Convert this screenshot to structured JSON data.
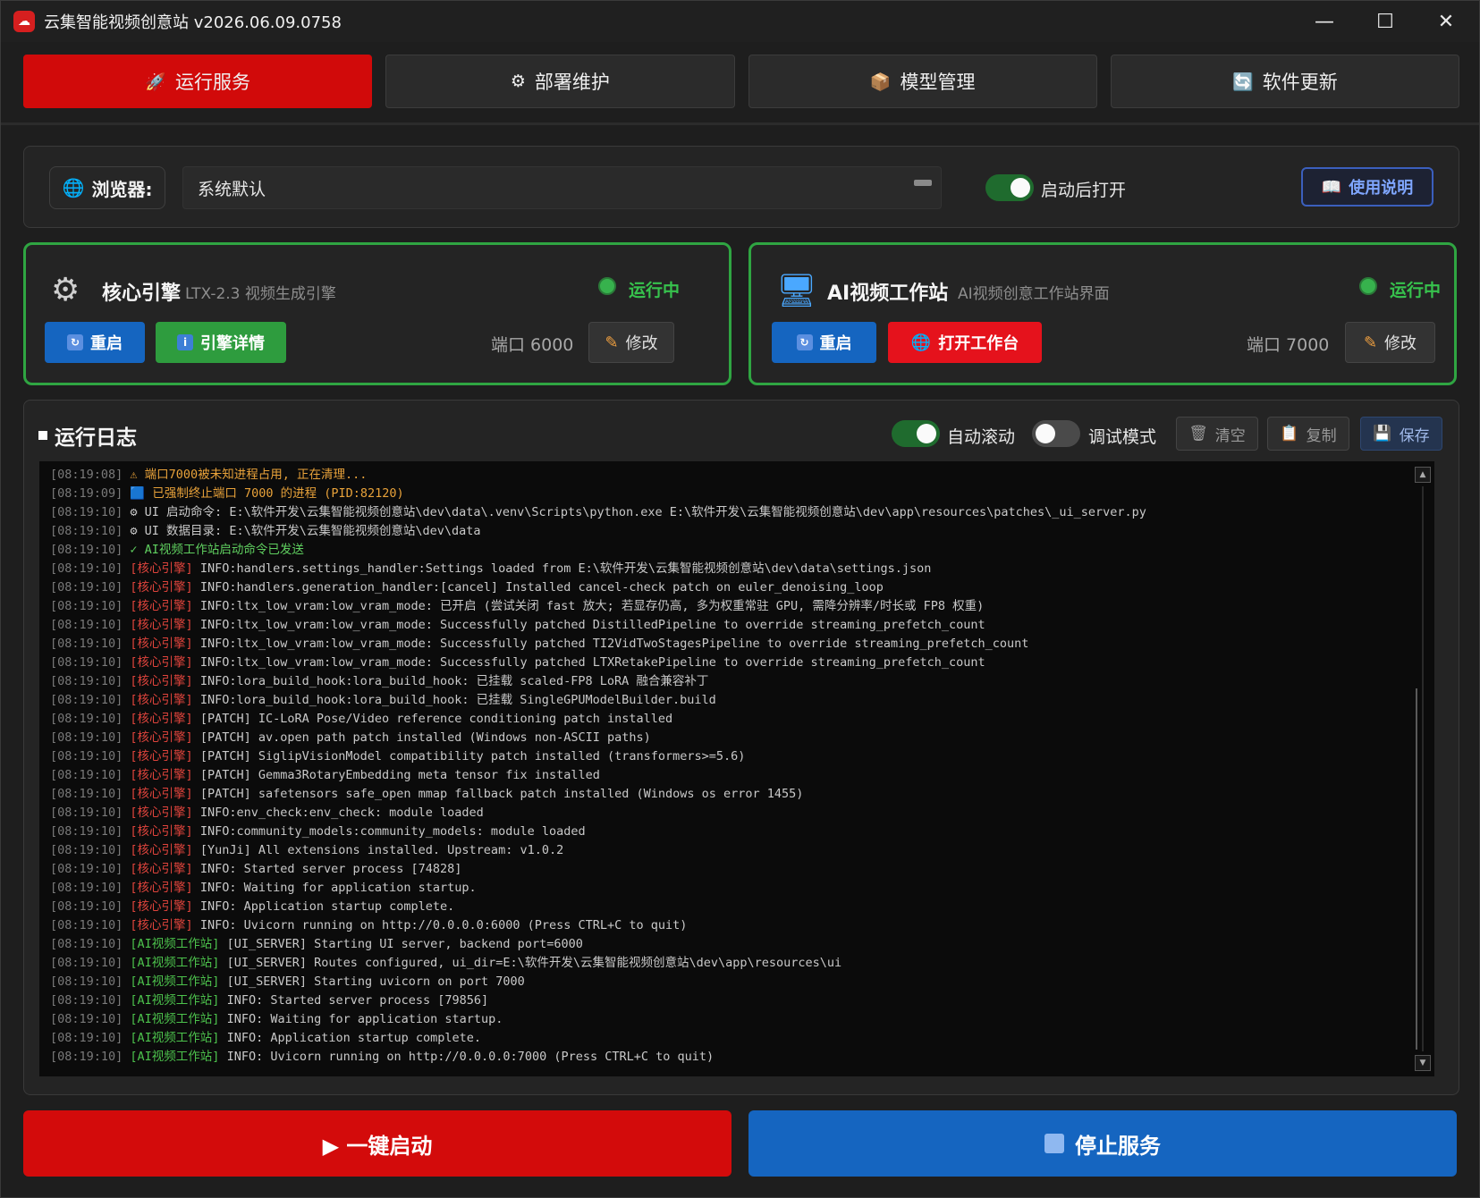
{
  "window": {
    "title": "云集智能视频创意站 v2026.06.09.0758",
    "minimize_label": "—",
    "maximize_label": "☐",
    "close_label": "✕"
  },
  "tabs": [
    {
      "icon": "🚀",
      "label": "运行服务",
      "active": true
    },
    {
      "icon": "⚙",
      "label": "部署维护",
      "active": false
    },
    {
      "icon": "📦",
      "label": "模型管理",
      "active": false
    },
    {
      "icon": "🔄",
      "label": "软件更新",
      "active": false
    }
  ],
  "browser": {
    "label": "浏览器:",
    "selected": "系统默认",
    "open_after_launch_label": "启动后打开",
    "open_after_launch": true,
    "manual_label": "使用说明"
  },
  "services": {
    "core": {
      "name": "核心引擎",
      "subtitle": "LTX-2.3 视频生成引擎",
      "status": "运行中",
      "restart_label": "重启",
      "details_label": "引擎详情",
      "port_text": "端口 6000",
      "edit_label": "修改"
    },
    "studio": {
      "name": "AI视频工作站",
      "subtitle": "AI视频创意工作站界面",
      "status": "运行中",
      "restart_label": "重启",
      "open_label": "打开工作台",
      "port_text": "端口 7000",
      "edit_label": "修改"
    }
  },
  "log": {
    "title": "运行日志",
    "auto_scroll_label": "自动滚动",
    "auto_scroll": true,
    "debug_label": "调试模式",
    "debug": false,
    "clear_label": "清空",
    "copy_label": "复制",
    "save_label": "保存",
    "colors": {
      "timestamp": "#7a7a7a",
      "warn": "#e8a23a",
      "info": "#c9c9c9",
      "success": "#5fcf5f",
      "core_tag": "#e0443c",
      "studio_tag": "#4cc24c"
    },
    "lines": [
      {
        "ts": "[08:19:08]",
        "tag": "",
        "tag_color": "",
        "msg": "⚠ 端口7000被未知进程占用, 正在清理...",
        "color": "#e8a23a"
      },
      {
        "ts": "[08:19:09]",
        "tag": "",
        "tag_color": "",
        "msg": "🟦 已强制终止端口 7000 的进程 (PID:82120)",
        "color": "#e8a23a"
      },
      {
        "ts": "[08:19:10]",
        "tag": "",
        "tag_color": "",
        "msg": "⚙ UI 启动命令: E:\\软件开发\\云集智能视频创意站\\dev\\data\\.venv\\Scripts\\python.exe E:\\软件开发\\云集智能视频创意站\\dev\\app\\resources\\patches\\_ui_server.py",
        "color": "#c9c9c9"
      },
      {
        "ts": "[08:19:10]",
        "tag": "",
        "tag_color": "",
        "msg": "⚙ UI 数据目录: E:\\软件开发\\云集智能视频创意站\\dev\\data",
        "color": "#c9c9c9"
      },
      {
        "ts": "[08:19:10]",
        "tag": "",
        "tag_color": "",
        "msg": "✓ AI视频工作站启动命令已发送",
        "color": "#5fcf5f"
      },
      {
        "ts": "[08:19:10]",
        "tag": "[核心引擎]",
        "tag_color": "#e0443c",
        "msg": "INFO:handlers.settings_handler:Settings loaded from E:\\软件开发\\云集智能视频创意站\\dev\\data\\settings.json",
        "color": "#c9c9c9"
      },
      {
        "ts": "[08:19:10]",
        "tag": "[核心引擎]",
        "tag_color": "#e0443c",
        "msg": "INFO:handlers.generation_handler:[cancel] Installed cancel-check patch on euler_denoising_loop",
        "color": "#c9c9c9"
      },
      {
        "ts": "[08:19:10]",
        "tag": "[核心引擎]",
        "tag_color": "#e0443c",
        "msg": "INFO:ltx_low_vram:low_vram_mode: 已开启 (尝试关闭 fast 放大; 若显存仍高, 多为权重常驻 GPU, 需降分辨率/时长或 FP8 权重)",
        "color": "#c9c9c9"
      },
      {
        "ts": "[08:19:10]",
        "tag": "[核心引擎]",
        "tag_color": "#e0443c",
        "msg": "INFO:ltx_low_vram:low_vram_mode: Successfully patched DistilledPipeline to override streaming_prefetch_count",
        "color": "#c9c9c9"
      },
      {
        "ts": "[08:19:10]",
        "tag": "[核心引擎]",
        "tag_color": "#e0443c",
        "msg": "INFO:ltx_low_vram:low_vram_mode: Successfully patched TI2VidTwoStagesPipeline to override streaming_prefetch_count",
        "color": "#c9c9c9"
      },
      {
        "ts": "[08:19:10]",
        "tag": "[核心引擎]",
        "tag_color": "#e0443c",
        "msg": "INFO:ltx_low_vram:low_vram_mode: Successfully patched LTXRetakePipeline to override streaming_prefetch_count",
        "color": "#c9c9c9"
      },
      {
        "ts": "[08:19:10]",
        "tag": "[核心引擎]",
        "tag_color": "#e0443c",
        "msg": "INFO:lora_build_hook:lora_build_hook: 已挂载 scaled-FP8 LoRA 融合兼容补丁",
        "color": "#c9c9c9"
      },
      {
        "ts": "[08:19:10]",
        "tag": "[核心引擎]",
        "tag_color": "#e0443c",
        "msg": "INFO:lora_build_hook:lora_build_hook: 已挂载 SingleGPUModelBuilder.build",
        "color": "#c9c9c9"
      },
      {
        "ts": "[08:19:10]",
        "tag": "[核心引擎]",
        "tag_color": "#e0443c",
        "msg": "[PATCH] IC-LoRA Pose/Video reference conditioning patch installed",
        "color": "#c9c9c9"
      },
      {
        "ts": "[08:19:10]",
        "tag": "[核心引擎]",
        "tag_color": "#e0443c",
        "msg": "[PATCH] av.open path patch installed (Windows non-ASCII paths)",
        "color": "#c9c9c9"
      },
      {
        "ts": "[08:19:10]",
        "tag": "[核心引擎]",
        "tag_color": "#e0443c",
        "msg": "[PATCH] SiglipVisionModel compatibility patch installed (transformers>=5.6)",
        "color": "#c9c9c9"
      },
      {
        "ts": "[08:19:10]",
        "tag": "[核心引擎]",
        "tag_color": "#e0443c",
        "msg": "[PATCH] Gemma3RotaryEmbedding meta tensor fix installed",
        "color": "#c9c9c9"
      },
      {
        "ts": "[08:19:10]",
        "tag": "[核心引擎]",
        "tag_color": "#e0443c",
        "msg": "[PATCH] safetensors safe_open mmap fallback patch installed (Windows os error 1455)",
        "color": "#c9c9c9"
      },
      {
        "ts": "[08:19:10]",
        "tag": "[核心引擎]",
        "tag_color": "#e0443c",
        "msg": "INFO:env_check:env_check: module loaded",
        "color": "#c9c9c9"
      },
      {
        "ts": "[08:19:10]",
        "tag": "[核心引擎]",
        "tag_color": "#e0443c",
        "msg": "INFO:community_models:community_models: module loaded",
        "color": "#c9c9c9"
      },
      {
        "ts": "[08:19:10]",
        "tag": "[核心引擎]",
        "tag_color": "#e0443c",
        "msg": "[YunJi] All extensions installed. Upstream: v1.0.2",
        "color": "#c9c9c9"
      },
      {
        "ts": "[08:19:10]",
        "tag": "[核心引擎]",
        "tag_color": "#e0443c",
        "msg": "INFO: Started server process [74828]",
        "color": "#c9c9c9"
      },
      {
        "ts": "[08:19:10]",
        "tag": "[核心引擎]",
        "tag_color": "#e0443c",
        "msg": "INFO: Waiting for application startup.",
        "color": "#c9c9c9"
      },
      {
        "ts": "[08:19:10]",
        "tag": "[核心引擎]",
        "tag_color": "#e0443c",
        "msg": "INFO: Application startup complete.",
        "color": "#c9c9c9"
      },
      {
        "ts": "[08:19:10]",
        "tag": "[核心引擎]",
        "tag_color": "#e0443c",
        "msg": "INFO: Uvicorn running on http://0.0.0.0:6000 (Press CTRL+C to quit)",
        "color": "#c9c9c9"
      },
      {
        "ts": "[08:19:10]",
        "tag": "[AI视频工作站]",
        "tag_color": "#4cc24c",
        "msg": "[UI_SERVER] Starting UI server, backend port=6000",
        "color": "#c9c9c9"
      },
      {
        "ts": "[08:19:10]",
        "tag": "[AI视频工作站]",
        "tag_color": "#4cc24c",
        "msg": "[UI_SERVER] Routes configured, ui_dir=E:\\软件开发\\云集智能视频创意站\\dev\\app\\resources\\ui",
        "color": "#c9c9c9"
      },
      {
        "ts": "[08:19:10]",
        "tag": "[AI视频工作站]",
        "tag_color": "#4cc24c",
        "msg": "[UI_SERVER] Starting uvicorn on port 7000",
        "color": "#c9c9c9"
      },
      {
        "ts": "[08:19:10]",
        "tag": "[AI视频工作站]",
        "tag_color": "#4cc24c",
        "msg": "INFO: Started server process [79856]",
        "color": "#c9c9c9"
      },
      {
        "ts": "[08:19:10]",
        "tag": "[AI视频工作站]",
        "tag_color": "#4cc24c",
        "msg": "INFO: Waiting for application startup.",
        "color": "#c9c9c9"
      },
      {
        "ts": "[08:19:10]",
        "tag": "[AI视频工作站]",
        "tag_color": "#4cc24c",
        "msg": "INFO: Application startup complete.",
        "color": "#c9c9c9"
      },
      {
        "ts": "[08:19:10]",
        "tag": "[AI视频工作站]",
        "tag_color": "#4cc24c",
        "msg": "INFO: Uvicorn running on http://0.0.0.0:7000 (Press CTRL+C to quit)",
        "color": "#c9c9c9"
      }
    ]
  },
  "actions": {
    "start_label": "▶ 一键启动",
    "stop_label": "停止服务"
  }
}
